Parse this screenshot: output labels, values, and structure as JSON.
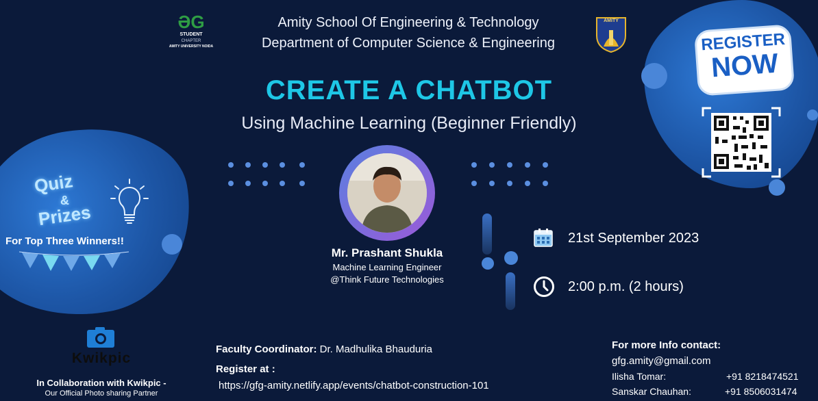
{
  "header": {
    "line1": "Amity School Of Engineering & Technology",
    "line2": "Department of Computer Science & Engineering"
  },
  "logos": {
    "gfg_text": "ƏG",
    "gfg_line1": "STUDENT",
    "gfg_line2": "CHAPTER",
    "gfg_line3": "AMITY UNIVERSITY NOIDA",
    "amity_text": "AMITY"
  },
  "event": {
    "title": "CREATE A CHATBOT",
    "subtitle": "Using Machine Learning (Beginner Friendly)"
  },
  "speaker": {
    "name": "Mr. Prashant Shukla",
    "role": "Machine Learning Engineer",
    "org": "@Think Future Technologies"
  },
  "schedule": {
    "date": "21st September 2023",
    "time": "2:00 p.m. (2 hours)"
  },
  "quiz": {
    "word1": "Quiz",
    "amp": "&",
    "word2": "Prizes",
    "tagline": "For Top Three Winners!!"
  },
  "register_badge": {
    "line1": "REGISTER",
    "line2": "NOW"
  },
  "partner": {
    "name": "Kwikpic",
    "collab": "In Collaboration with Kwikpic -",
    "desc": "Our Official Photo sharing Partner"
  },
  "faculty": {
    "label": "Faculty Coordinator:",
    "name": " Dr. Madhulika Bhauduria"
  },
  "register": {
    "label": "Register at :",
    "url": "https://gfg-amity.netlify.app/events/chatbot-construction-101"
  },
  "contact": {
    "heading": "For more Info contact:",
    "email": "gfg.amity@gmail.com",
    "people": [
      {
        "name": "Ilisha Tomar:",
        "phone": "+91 8218474521"
      },
      {
        "name": "Sanskar Chauhan:",
        "phone": "+91 8506031474"
      }
    ]
  },
  "colors": {
    "background": "#0b1a3a",
    "title": "#1ec7e6",
    "blob": "#1d56a6",
    "accent_purple": "#8a5cd8"
  }
}
